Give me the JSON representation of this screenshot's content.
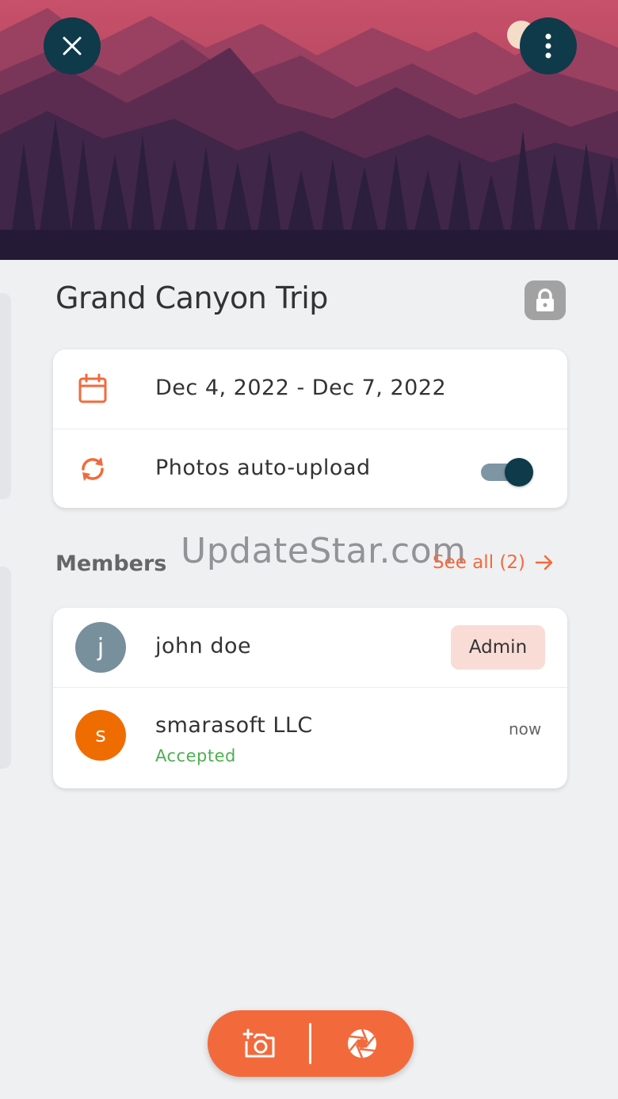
{
  "header": {
    "close_icon": "close-icon",
    "more_icon": "more-vertical-icon",
    "image": "mountain-sunset-illustration"
  },
  "trip": {
    "title": "Grand Canyon Trip",
    "lock_icon": "lock-icon"
  },
  "info_card": {
    "date_icon": "calendar-icon",
    "date_range": "Dec 4, 2022 - Dec 7, 2022",
    "upload_icon": "sync-icon",
    "auto_upload_label": "Photos auto-upload",
    "auto_upload_enabled": true
  },
  "members": {
    "label": "Members",
    "see_all": "See all (2)",
    "list": [
      {
        "initial": "j",
        "name": "john doe",
        "badge": "Admin",
        "avatar_color": "#78909c"
      },
      {
        "initial": "s",
        "name": "smarasoft LLC",
        "status": "Accepted",
        "time": "now",
        "avatar_color": "#ef6c00"
      }
    ]
  },
  "watermark": "UpdateStar.com",
  "fab": {
    "left_icon": "add-photo-icon",
    "right_icon": "camera-shutter-icon"
  },
  "colors": {
    "accent": "#f26a3c",
    "dark": "#0e3a4a",
    "accepted": "#4caf50"
  }
}
